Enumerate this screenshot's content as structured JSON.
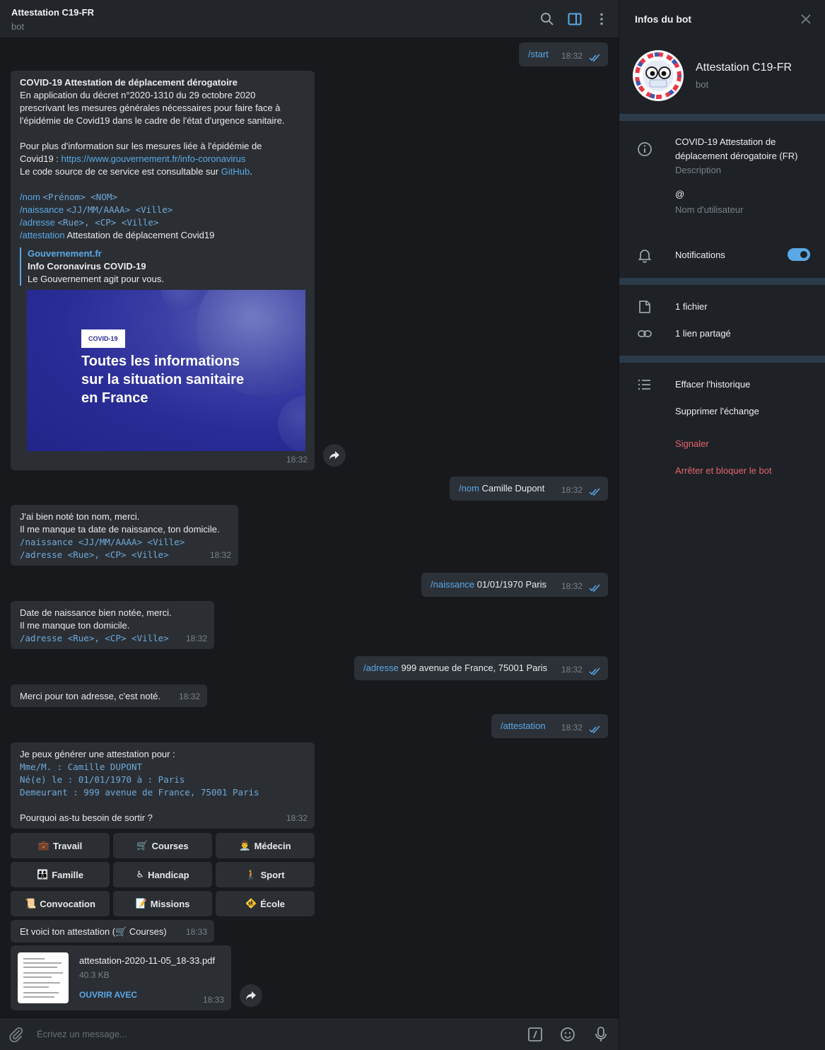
{
  "colors": {
    "accent": "#5aa9e6",
    "danger": "#e5636b",
    "bubble": "#2b2f34",
    "background": "#17191c"
  },
  "header": {
    "title": "Attestation C19-FR",
    "subtitle": "bot"
  },
  "messages": {
    "m1": {
      "cmd": "/start",
      "time": "18:32"
    },
    "m2": {
      "title": "COVID-19 Attestation de déplacement dérogatoire",
      "p1": [
        "En application du décret n°2020-1310 du 29 octobre 2020",
        "prescrivant les mesures générales nécessaires pour faire face à",
        "l'épidémie de Covid19 dans le cadre de l'état d'urgence sanitaire."
      ],
      "p2a": "Pour plus d'information sur les mesures liée à l'épidémie de",
      "p2b_prefix": "Covid19 : ",
      "p2b_link": "https://www.gouvernement.fr/info-coronavirus",
      "p3_prefix": "Le code source de ce service est consultable sur ",
      "p3_link": "GitHub",
      "p3_suffix": ".",
      "cmds": [
        {
          "cmd": "/nom",
          "args": "<Prénom> <NOM>"
        },
        {
          "cmd": "/naissance",
          "args": "<JJ/MM/AAAA> <Ville>"
        },
        {
          "cmd": "/adresse",
          "args": "<Rue>, <CP> <Ville>"
        },
        {
          "cmd": "/attestation",
          "args": "Attestation de déplacement Covid19"
        }
      ],
      "preview": {
        "site": "Gouvernement.fr",
        "title": "Info Coronavirus COVID-19",
        "desc": "Le Gouvernement agit pour vous.",
        "tag": "COVID-19",
        "headline": [
          "Toutes les informations",
          "sur la situation sanitaire",
          "en France"
        ]
      },
      "time": "18:32"
    },
    "m3": {
      "cmd": "/nom",
      "text": " Camille Dupont",
      "time": "18:32"
    },
    "m4": {
      "lines": [
        "J'ai bien noté ton nom, merci.",
        "Il me manque ta date de naissance, ton domicile."
      ],
      "code": [
        "/naissance <JJ/MM/AAAA> <Ville>",
        "/adresse <Rue>, <CP> <Ville>"
      ],
      "time": "18:32"
    },
    "m5": {
      "cmd": "/naissance",
      "text": " 01/01/1970 Paris",
      "time": "18:32"
    },
    "m6": {
      "lines": [
        "Date de naissance bien notée, merci.",
        "Il me manque ton domicile."
      ],
      "code": [
        "/adresse <Rue>, <CP> <Ville>"
      ],
      "time": "18:32"
    },
    "m7": {
      "cmd": "/adresse",
      "text": " 999 avenue de France, 75001 Paris",
      "time": "18:32"
    },
    "m8": {
      "text": "Merci pour ton adresse, c'est noté.",
      "time": "18:32"
    },
    "m9": {
      "cmd": "/attestation",
      "time": "18:32"
    },
    "m10": {
      "intro": "Je peux générer une attestation pour :",
      "code": [
        "Mme/M. : Camille DUPONT",
        "Né(e) le : 01/01/1970 à : Paris",
        "Demeurant : 999 avenue de France, 75001 Paris"
      ],
      "question": "Pourquoi as-tu besoin de sortir ?",
      "time": "18:32"
    },
    "keyboard": [
      {
        "emoji": "💼",
        "label": "Travail"
      },
      {
        "emoji": "🛒",
        "label": "Courses"
      },
      {
        "emoji": "👨‍⚕️",
        "label": "Médecin"
      },
      {
        "emoji": "👪",
        "label": "Famille"
      },
      {
        "emoji": "♿",
        "label": "Handicap"
      },
      {
        "emoji": "🚶",
        "label": "Sport"
      },
      {
        "emoji": "📜",
        "label": "Convocation"
      },
      {
        "emoji": "📝",
        "label": "Missions"
      },
      {
        "emoji": "🚸",
        "label": "École"
      }
    ],
    "m11": {
      "text": "Et voici ton attestation (🛒 Courses)",
      "time": "18:33"
    },
    "m12": {
      "filename": "attestation-2020-11-05_18-33.pdf",
      "size": "40.3 KB",
      "action": "OUVRIR AVEC",
      "time": "18:33"
    }
  },
  "composer": {
    "placeholder": "Écrivez un message..."
  },
  "info": {
    "title": "Infos du bot",
    "name": "Attestation C19-FR",
    "sub": "bot",
    "description": [
      "COVID-19 Attestation de",
      "déplacement dérogatoire (FR)"
    ],
    "description_label": "Description",
    "username": "@",
    "username_label": "Nom d'utilisateur",
    "notifications": "Notifications",
    "files": "1 fichier",
    "links": "1 lien partagé",
    "clear": "Effacer l'historique",
    "delete": "Supprimer l'échange",
    "report": "Signaler",
    "block": "Arrêter et bloquer le bot"
  }
}
